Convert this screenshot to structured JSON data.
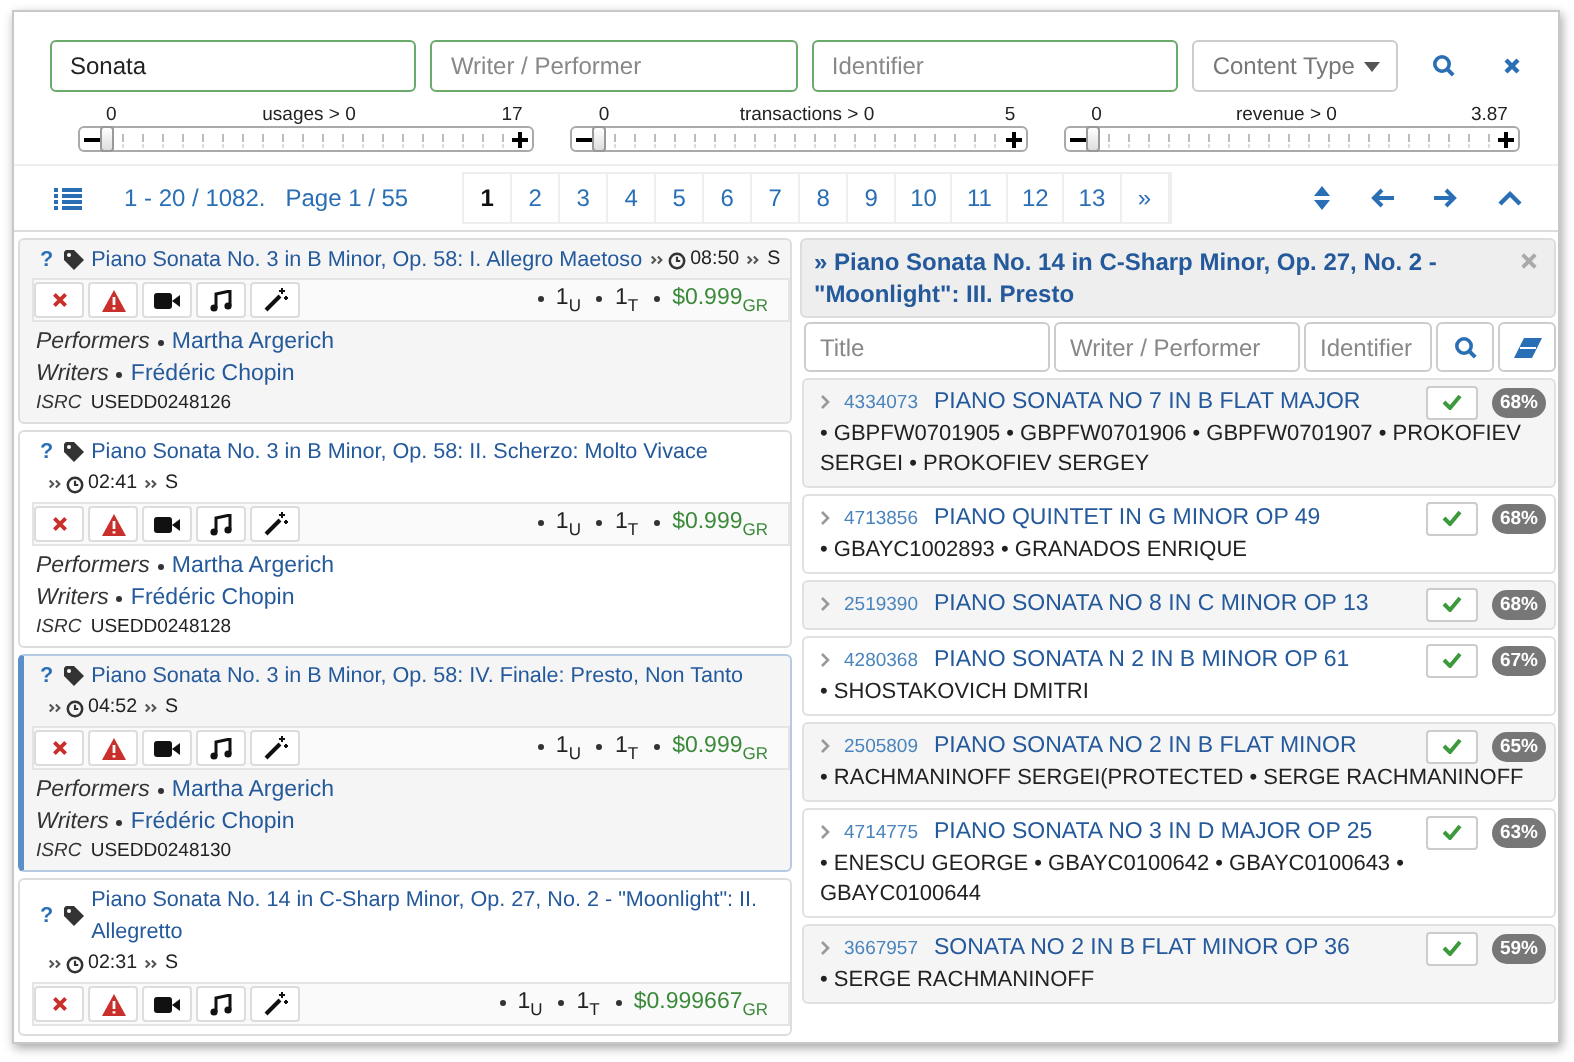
{
  "search": {
    "fields": [
      {
        "value": "Sonata"
      },
      {
        "placeholder": "Writer / Performer"
      },
      {
        "placeholder": "Identifier"
      }
    ],
    "content_type": {
      "placeholder": "Content Type"
    }
  },
  "sliders": [
    {
      "min": "0",
      "label": "usages > 0",
      "max": "17",
      "level": 0
    },
    {
      "min": "0",
      "label": "transactions > 0",
      "max": "5",
      "level": 0
    },
    {
      "min": "0",
      "label": "revenue > 0",
      "max": "3.87",
      "level": 0
    }
  ],
  "pagination": {
    "range": "1 - 20 / 1082.",
    "page": "Page 1 / 55",
    "pages": [
      {
        "label": "1",
        "selected": true
      },
      {
        "label": "2",
        "selected": false
      },
      {
        "label": "3",
        "selected": false
      },
      {
        "label": "4",
        "selected": false
      },
      {
        "label": "5",
        "selected": false
      },
      {
        "label": "6",
        "selected": false
      },
      {
        "label": "7",
        "selected": false
      },
      {
        "label": "8",
        "selected": false
      },
      {
        "label": "9",
        "selected": false
      },
      {
        "label": "10",
        "selected": false
      },
      {
        "label": "11",
        "selected": false
      },
      {
        "label": "12",
        "selected": false
      },
      {
        "label": "13",
        "selected": false
      },
      {
        "label": "»",
        "selected": false
      }
    ]
  },
  "tracks": [
    {
      "help": "?",
      "title": "Piano Sonata No. 3 in B Minor, Op. 58: I. Allegro Maetoso",
      "duration": "08:50",
      "type": "S",
      "selected": false,
      "stats": [
        {
          "kind": "count",
          "value": "1",
          "unit": "U"
        },
        {
          "kind": "count",
          "value": "1",
          "unit": "T"
        },
        {
          "kind": "revenue",
          "value": "$0.999",
          "unit": "GR"
        }
      ],
      "performers_label": "Performers",
      "performers": "Martha Argerich",
      "writers_label": "Writers",
      "writers": "Frédéric Chopin",
      "isrc_label": "ISRC",
      "isrc": "USEDD0248126"
    },
    {
      "help": "?",
      "title": "Piano Sonata No. 3 in B Minor, Op. 58: II. Scherzo: Molto Vivace",
      "duration": "02:41",
      "type": "S",
      "selected": false,
      "stats": [
        {
          "kind": "count",
          "value": "1",
          "unit": "U"
        },
        {
          "kind": "count",
          "value": "1",
          "unit": "T"
        },
        {
          "kind": "revenue",
          "value": "$0.999",
          "unit": "GR"
        }
      ],
      "performers_label": "Performers",
      "performers": "Martha Argerich",
      "writers_label": "Writers",
      "writers": "Frédéric Chopin",
      "isrc_label": "ISRC",
      "isrc": "USEDD0248128"
    },
    {
      "help": "?",
      "title": "Piano Sonata No. 3 in B Minor, Op. 58: IV. Finale: Presto, Non Tanto",
      "duration": "04:52",
      "type": "S",
      "selected": true,
      "stats": [
        {
          "kind": "count",
          "value": "1",
          "unit": "U"
        },
        {
          "kind": "count",
          "value": "1",
          "unit": "T"
        },
        {
          "kind": "revenue",
          "value": "$0.999",
          "unit": "GR"
        }
      ],
      "performers_label": "Performers",
      "performers": "Martha Argerich",
      "writers_label": "Writers",
      "writers": "Frédéric Chopin",
      "isrc_label": "ISRC",
      "isrc": "USEDD0248130"
    },
    {
      "help": "?",
      "title": "Piano Sonata No. 14 in C-Sharp Minor, Op. 27, No. 2 - \"Moonlight\": II. Allegretto",
      "duration": "02:31",
      "type": "S",
      "selected": false,
      "stats": [
        {
          "kind": "count",
          "value": "1",
          "unit": "U"
        },
        {
          "kind": "count",
          "value": "1",
          "unit": "T"
        },
        {
          "kind": "revenue",
          "value": "$0.999667",
          "unit": "GR"
        }
      ]
    }
  ],
  "match_panel": {
    "title": "» Piano Sonata No. 14 in C-Sharp Minor, Op. 27, No. 2 - \"Moonlight\": III. Presto",
    "filters": [
      {
        "placeholder": "Title"
      },
      {
        "placeholder": "Writer / Performer"
      },
      {
        "placeholder": "Identifier"
      }
    ],
    "results": [
      {
        "id": "4334073",
        "title": "PIANO SONATA NO 7 IN B FLAT MAJOR",
        "details": "• GBPFW0701905 • GBPFW0701906 • GBPFW0701907 • PROKOFIEV SERGEI • PROKOFIEV SERGEY",
        "score": "68%"
      },
      {
        "id": "4713856",
        "title": "PIANO QUINTET IN G MINOR OP 49",
        "details": "• GBAYC1002893 • GRANADOS ENRIQUE",
        "score": "68%"
      },
      {
        "id": "2519390",
        "title": "PIANO SONATA NO 8 IN C MINOR OP 13",
        "score": "68%"
      },
      {
        "id": "4280368",
        "title": "PIANO SONATA N 2 IN B MINOR OP 61",
        "details": "• SHOSTAKOVICH DMITRI",
        "score": "67%"
      },
      {
        "id": "2505809",
        "title": "PIANO SONATA NO 2 IN B FLAT MINOR",
        "details": "• RACHMANINOFF SERGEI(PROTECTED • SERGE RACHMANINOFF",
        "score": "65%"
      },
      {
        "id": "4714775",
        "title": "PIANO SONATA NO 3 IN D MAJOR OP 25",
        "details": "• ENESCU GEORGE • GBAYC0100642 • GBAYC0100643 • GBAYC0100644",
        "score": "63%"
      },
      {
        "id": "3667957",
        "title": "SONATA NO 2 IN B FLAT MINOR OP 36",
        "details": "• SERGE RACHMANINOFF",
        "score": "59%"
      }
    ]
  }
}
